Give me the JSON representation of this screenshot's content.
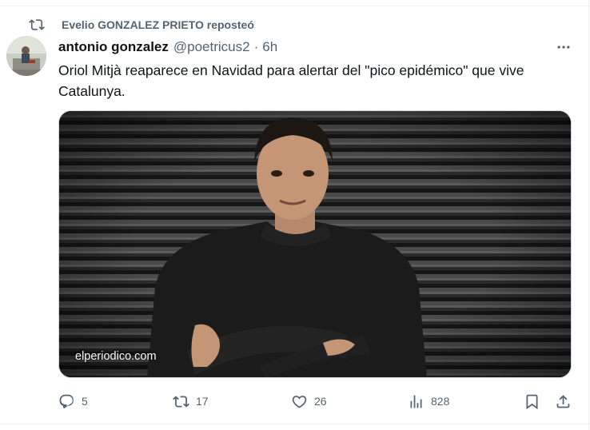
{
  "repost": {
    "icon": "repost-icon",
    "text": "Evelio GONZALEZ PRIETO reposteó"
  },
  "author": {
    "avatar_icon": "avatar",
    "name": "antonio gonzalez",
    "handle": "@poetricus2",
    "separator": "·",
    "time": "6h"
  },
  "more_icon": "more-icon",
  "tweet": {
    "text": "Oriol Mitjà reaparece en Navidad para alertar del \"pico epidémico\" que vive Catalunya."
  },
  "media": {
    "source": "elperiodico.com"
  },
  "actions": {
    "reply_count": "5",
    "repost_count": "17",
    "like_count": "26",
    "views_count": "828"
  },
  "colors": {
    "text": "#0f1419",
    "secondary": "#536471",
    "border": "#eff3f4"
  }
}
